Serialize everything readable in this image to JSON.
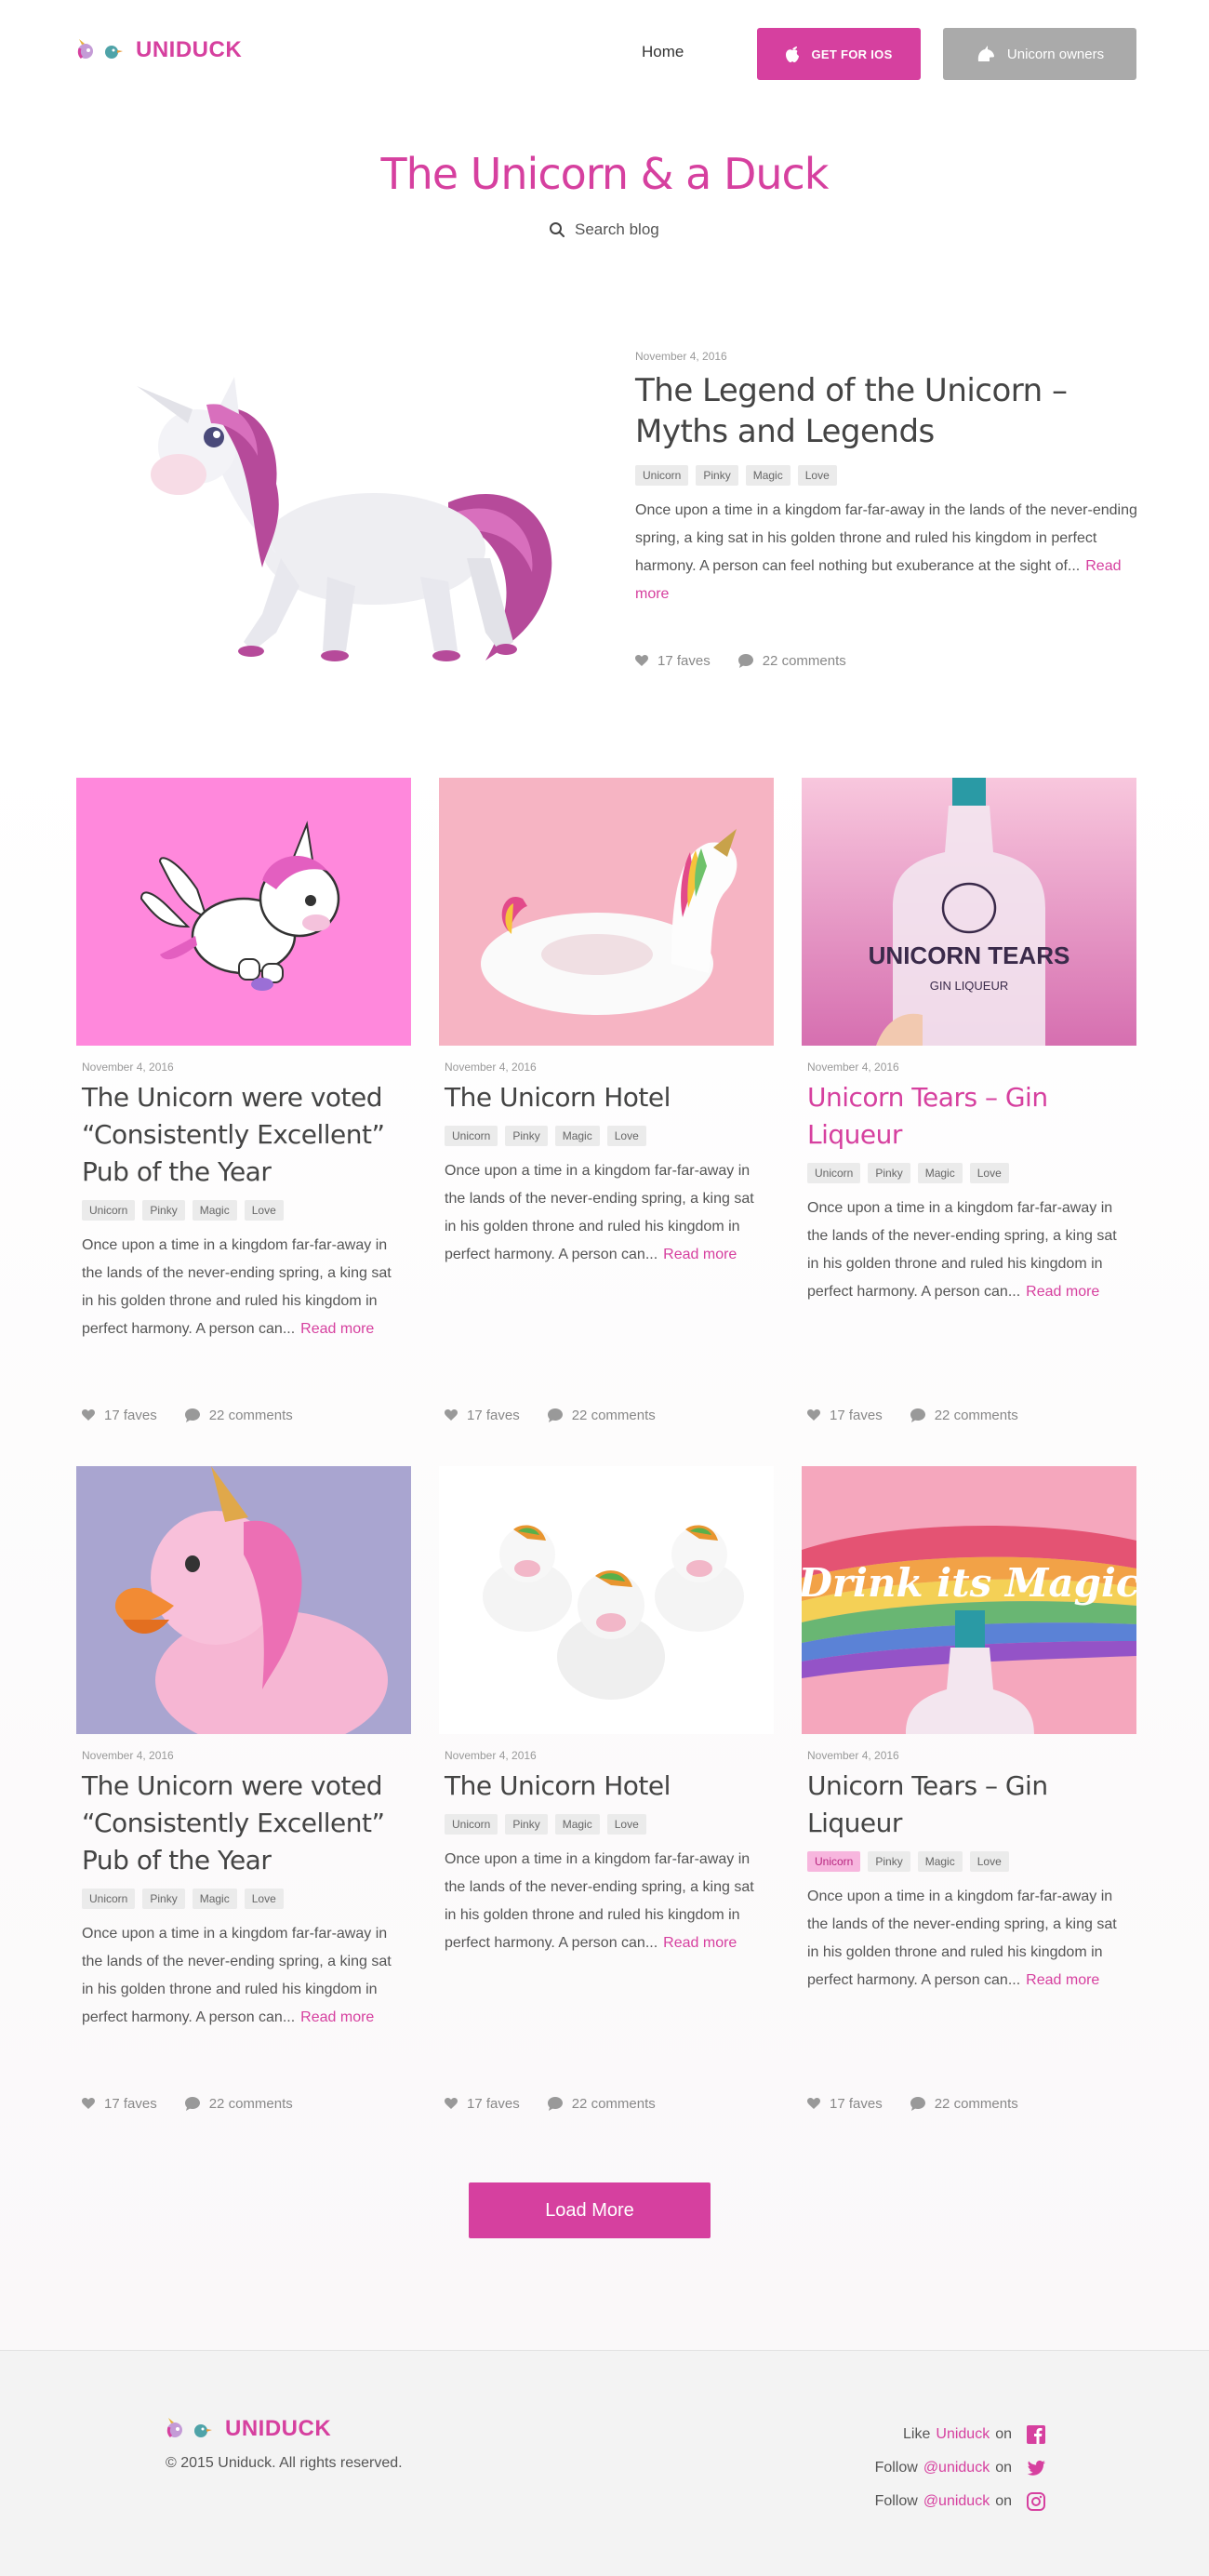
{
  "header": {
    "brand": "UNIDUCK",
    "nav_home": "Home",
    "ios_button": "GET FOR IOS",
    "owners_button": "Unicorn owners"
  },
  "hero": {
    "title": "The Unicorn & a Duck",
    "search_label": "Search blog"
  },
  "featured": {
    "date": "November 4, 2016",
    "title": "The Legend of the Unicorn – Myths and Legends",
    "tags": [
      "Unicorn",
      "Pinky",
      "Magic",
      "Love"
    ],
    "excerpt": "Once upon a time in a kingdom far-far-away in the lands of the never-ending spring, a king sat in his golden throne and ruled his kingdom in perfect harmony. A person can feel nothing but exuberance at the sight of...",
    "read_more": "Read more",
    "faves": "17 faves",
    "comments": "22 comments"
  },
  "cards": [
    {
      "date": "November 4, 2016",
      "title": "The Unicorn were voted “Consistently Excellent” Pub of the Year",
      "tags": [
        "Unicorn",
        "Pinky",
        "Magic",
        "Love"
      ],
      "excerpt": "Once upon a time in a kingdom far-far-away in the lands of the never-ending spring, a king sat in his golden throne and ruled his kingdom in perfect harmony. A person can...",
      "read_more": "Read more",
      "faves": "17 faves",
      "comments": "22 comments"
    },
    {
      "date": "November 4, 2016",
      "title": "The Unicorn Hotel",
      "tags": [
        "Unicorn",
        "Pinky",
        "Magic",
        "Love"
      ],
      "excerpt": "Once upon a time in a kingdom far-far-away in the lands of the never-ending spring, a king sat in his golden throne and ruled his kingdom in perfect harmony. A person can...",
      "read_more": "Read more",
      "faves": "17 faves",
      "comments": "22 comments"
    },
    {
      "date": "November 4, 2016",
      "title": "Unicorn Tears – Gin Liqueur",
      "tags": [
        "Unicorn",
        "Pinky",
        "Magic",
        "Love"
      ],
      "excerpt": "Once upon a time in a kingdom far-far-away in the lands of the never-ending spring, a king sat in his golden throne and ruled his kingdom in perfect harmony. A person can...",
      "read_more": "Read more",
      "faves": "17 faves",
      "comments": "22 comments",
      "bottle_text": "UNICORN TEARS",
      "bottle_subtext": "GIN LIQUEUR"
    },
    {
      "date": "November 4, 2016",
      "title": "The Unicorn were voted “Consistently Excellent” Pub of the Year",
      "tags": [
        "Unicorn",
        "Pinky",
        "Magic",
        "Love"
      ],
      "excerpt": "Once upon a time in a kingdom far-far-away in the lands of the never-ending spring, a king sat in his golden throne and ruled his kingdom in perfect harmony. A person can...",
      "read_more": "Read more",
      "faves": "17 faves",
      "comments": "22 comments"
    },
    {
      "date": "November 4, 2016",
      "title": "The Unicorn Hotel",
      "tags": [
        "Unicorn",
        "Pinky",
        "Magic",
        "Love"
      ],
      "excerpt": "Once upon a time in a kingdom far-far-away in the lands of the never-ending spring, a king sat in his golden throne and ruled his kingdom in perfect harmony. A person can...",
      "read_more": "Read more",
      "faves": "17 faves",
      "comments": "22 comments"
    },
    {
      "date": "November 4, 2016",
      "title": "Unicorn Tears – Gin Liqueur",
      "tags": [
        "Unicorn",
        "Pinky",
        "Magic",
        "Love"
      ],
      "excerpt": "Once upon a time in a kingdom far-far-away in the lands of the never-ending spring, a king sat in his golden throne and ruled his kingdom in perfect harmony. A person can...",
      "read_more": "Read more",
      "faves": "17 faves",
      "comments": "22 comments",
      "banner_text": "Drink its Magic"
    }
  ],
  "load_more": "Load More",
  "footer": {
    "brand": "UNIDUCK",
    "copyright": "© 2015 Uniduck. All rights reserved.",
    "like_prefix": "Like",
    "like_link": "Uniduck",
    "on": "on",
    "follow_prefix": "Follow",
    "twitter_link": "@uniduck",
    "instagram_link": "@uniduck"
  },
  "colors": {
    "accent": "#d6409f",
    "muted_button": "#aaaaaa",
    "tag_bg": "#ebebeb"
  }
}
